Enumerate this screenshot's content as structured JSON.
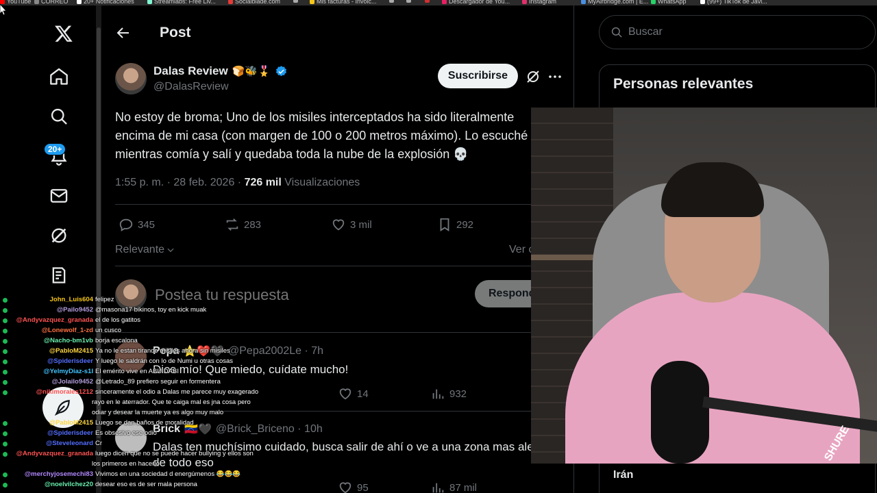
{
  "bookmarks": [
    {
      "label": "YouTube",
      "color": "#ff0000"
    },
    {
      "label": "CORREO",
      "color": "#888888"
    },
    {
      "label": "20+ Notificaciones",
      "color": "#ffffff"
    },
    {
      "label": "Streamlabs: Free Liv...",
      "color": "#80f5d2"
    },
    {
      "label": "Socialblade.com",
      "color": "#e53935"
    },
    {
      "label": "",
      "color": "#aaaaaa"
    },
    {
      "label": "Mis facturas - Invoic...",
      "color": "#f5c518"
    },
    {
      "label": "",
      "color": "#aaaaaa"
    },
    {
      "label": "",
      "color": "#aaaaaa"
    },
    {
      "label": "",
      "color": "#d32f2f"
    },
    {
      "label": "Descargador de You...",
      "color": "#e91e63"
    },
    {
      "label": "Instagram",
      "color": "#e1306c"
    },
    {
      "label": "MyAirbridge.com | E...",
      "color": "#4a90e2"
    },
    {
      "label": "WhatsApp",
      "color": "#25d366"
    },
    {
      "label": "(99+) TikTok de Javi...",
      "color": "#ffffff"
    }
  ],
  "nav": {
    "notif_badge": "20+"
  },
  "post": {
    "page_title": "Post",
    "author_name": "Dalas Review",
    "author_emojis": "🍞🐝🎖️",
    "author_handle": "@DalasReview",
    "subscribe_label": "Suscribirse",
    "text_line1": "No estoy de broma; Uno de los misiles interceptados ha sido literalmente",
    "text_line2": "encima de mi casa (con margen de 100 o 200 metros máximo). Lo escuché",
    "text_line3": "mientras comía y salí y quedaba toda la nube de la explosión 💀",
    "time": "1:55 p. m. · 28 feb. 2026 · ",
    "views_count": "726 mil",
    "views_label": " Visualizaciones",
    "replies": "345",
    "reposts": "283",
    "likes": "3 mil",
    "bookmarks": "292",
    "sort_label": "Relevante",
    "view_label": "Ver c",
    "reply_placeholder": "Postea tu respuesta",
    "reply_button": "Responder"
  },
  "replies": [
    {
      "name": "Pepa",
      "emojis": "⭐❤️🖤",
      "handle": "@Pepa2002Le · 7h",
      "text": "Dios mío! Que miedo, cuídate mucho!",
      "likes": "14",
      "views": "932"
    },
    {
      "name": "Brick",
      "emojis": "🇻🇪🖤",
      "handle": "@Brick_Briceno · 10h",
      "text": "Dalas ten muchísimo cuidado, busca salir de ahí o ve a una zona mas alej",
      "text2": "de todo eso",
      "likes": "95",
      "views": "87 mil"
    }
  ],
  "sidebar": {
    "search_placeholder": "Buscar",
    "relevant_title": "Personas relevantes",
    "trend": "Irán"
  },
  "webcam": {
    "mic_brand": "SHURE"
  },
  "chat": [
    {
      "user": "John_Luis604",
      "msg": "felipez",
      "color": "#f5c518"
    },
    {
      "user": "@Pailo9452",
      "msg": "@masona17 bikinos, toy en kick muak",
      "color": "#b39ddb"
    },
    {
      "user": "@Andyvazquez_granada",
      "msg": "el de los gatitos",
      "color": "#ff5252"
    },
    {
      "user": "@Lonewolf_1-zd",
      "msg": "un cusco",
      "color": "#ff7043"
    },
    {
      "user": "@Nacho-bm1vb",
      "msg": "borja escalona",
      "color": "#69f0ae"
    },
    {
      "user": "@PabloM2415",
      "msg": "Ya no le estan tirando misiles ahora sin misiles",
      "color": "#ffd740"
    },
    {
      "user": "@Spiderisdeer",
      "msg": "Y luego le saldrán con lo de Numi u otras cosas",
      "color": "#536dfe"
    },
    {
      "user": "@YelmyDiaz-s1I",
      "msg": "El emérito vive en ABU DABI",
      "color": "#40c4ff"
    },
    {
      "user": "@Jolailo9452",
      "msg": "@Letrado_89 prefiero seguir en formentera",
      "color": "#b39ddb"
    },
    {
      "user": "@nikimorales1212",
      "msg": "sinceramente el odio a Dalas me parece muy exagerado",
      "color": "#ff5252"
    },
    {
      "user": "",
      "msg": "rayo en le aterrador. Que te caiga mal es jna cosa pero",
      "color": "#ffffff"
    },
    {
      "user": "",
      "msg": "odiar y desear la muerte ya es algo muy malo",
      "color": "#ffffff"
    },
    {
      "user": "@PabloM2415",
      "msg": "Luego se dan baños de moralidad",
      "color": "#ffd740"
    },
    {
      "user": "@Spiderisdeer",
      "msg": "Es obsesivo ese odio",
      "color": "#536dfe"
    },
    {
      "user": "@Steveleonard",
      "msg": "Cr",
      "color": "#536dfe"
    },
    {
      "user": "@Andyvazquez_granada",
      "msg": "luego dicen que no se puede hacer bullying y ellos son",
      "color": "#ff5252"
    },
    {
      "user": "",
      "msg": "los primeros en hacerlo",
      "color": "#ffffff"
    },
    {
      "user": "@merchyjosemechi83",
      "msg": "Vivimos en una sociedad d energúmenos 😂😂😂",
      "color": "#b388ff"
    },
    {
      "user": "@noelvilchez20",
      "msg": "desear eso es de ser mala persona",
      "color": "#69f0ae"
    }
  ]
}
